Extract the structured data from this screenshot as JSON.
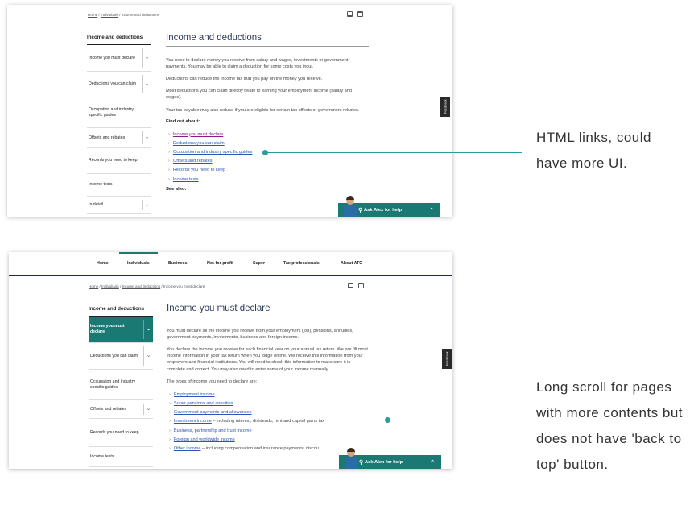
{
  "screen1": {
    "breadcrumb": {
      "home": "Home",
      "individuals": "Individuals",
      "current": "Income and deductions"
    },
    "sidenav": {
      "title": "Income and deductions",
      "items": [
        {
          "label": "Income you must declare",
          "expandable": true
        },
        {
          "label": "Deductions you can claim",
          "expandable": true
        },
        {
          "label": "Occupation and industry specific guides",
          "expandable": false
        },
        {
          "label": "Offsets and rebates",
          "expandable": true
        },
        {
          "label": "Records you need to keep",
          "expandable": false
        },
        {
          "label": "Income tests",
          "expandable": false
        },
        {
          "label": "In detail",
          "expandable": true
        }
      ]
    },
    "content": {
      "title": "Income and deductions",
      "paragraphs": [
        "You need to declare money you receive from salary and wages, investments or government payments. You may be able to claim a deduction for some costs you incur.",
        "Deductions can reduce the income tax that you pay on the money you receive.",
        "Most deductions you can claim directly relate to earning your employment income (salary and wages).",
        "Your tax payable may also reduce if you are eligible for certain tax offsets or government rebates."
      ],
      "find_out_title": "Find out about:",
      "links": [
        "Income you must declare",
        "Deductions you can claim",
        "Occupation and industry specific guides",
        "Offsets and rebates",
        "Records you need to keep",
        "Income tests"
      ],
      "see_also": "See also:"
    },
    "feedback_label": "Feedback",
    "ask_alex_label": "Ask Alex for help",
    "ask_alex_toggle": "^"
  },
  "screen2": {
    "topnav": [
      "Home",
      "Individuals",
      "Business",
      "Not-for-profit",
      "Super",
      "Tax professionals",
      "About ATO"
    ],
    "topnav_active": "Individuals",
    "breadcrumb": {
      "home": "Home",
      "individuals": "Individuals",
      "parent": "Income and deductions",
      "current": "Income you must declare"
    },
    "sidenav": {
      "title": "Income and deductions",
      "items": [
        {
          "label": "Income you must declare",
          "expandable": true,
          "active": true
        },
        {
          "label": "Deductions you can claim",
          "expandable": true
        },
        {
          "label": "Occupation and industry specific guides",
          "expandable": false
        },
        {
          "label": "Offsets and rebates",
          "expandable": true
        },
        {
          "label": "Records you need to keep",
          "expandable": false
        },
        {
          "label": "Income tests",
          "expandable": false
        }
      ]
    },
    "content": {
      "title": "Income you must declare",
      "paragraphs": [
        "You must declare all the income you receive from your employment (job), pensions, annuities, government payments, investments, business and foreign income.",
        "You declare the income you receive for each financial year on your annual tax return. We pre fill most income information in your tax return when you lodge online. We receive this information from your employers and financial institutions. You will need to check this information to make sure it is complete and correct. You may also need to enter some of your income manually.",
        "The types of income you need to declare are:"
      ],
      "links": [
        {
          "link": "Employment income",
          "suffix": ""
        },
        {
          "link": "Super pensions and annuities",
          "suffix": ""
        },
        {
          "link": "Government payments and allowances",
          "suffix": ""
        },
        {
          "link": "Investment income",
          "suffix": " – including interest, dividends, rent and capital gains tax"
        },
        {
          "link": "Business, partnership and trust income",
          "suffix": ""
        },
        {
          "link": "Foreign and worldwide income",
          "suffix": ""
        },
        {
          "link": "Other income",
          "suffix": " – including compensation and insurance payments, discou"
        }
      ]
    },
    "feedback_label": "Feedback",
    "ask_alex_label": "Ask Alex for help",
    "ask_alex_toggle": "^"
  },
  "annotations": {
    "first": "HTML links, could have more UI.",
    "second": "Long scroll for pages with more contents but does not have 'back to top' button.",
    "color": "#2a9da3"
  },
  "colors": {
    "teal": "#1a7a73",
    "navy": "#1e2a44",
    "link": "#2d55b8",
    "visited": "#8a1a8a"
  }
}
